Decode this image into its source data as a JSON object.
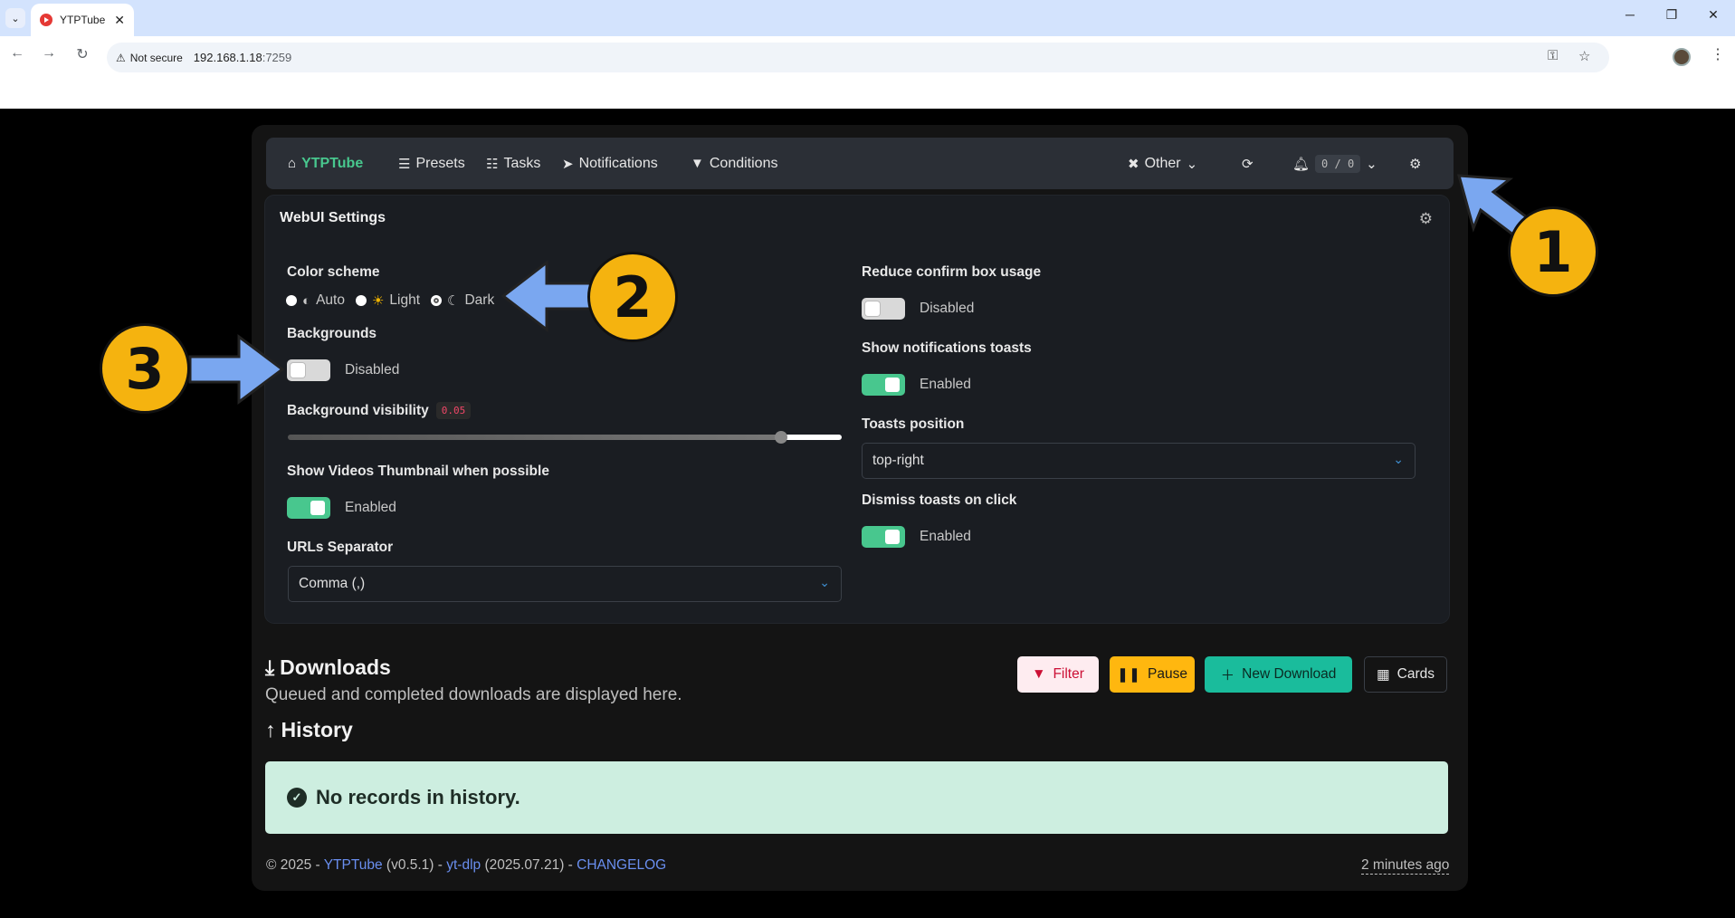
{
  "browser": {
    "tab_title": "YTPTube",
    "not_secure": "Not secure",
    "url_host": "192.168.1.18",
    "url_port": ":7259"
  },
  "nav": {
    "brand": "YTPTube",
    "presets": "Presets",
    "tasks": "Tasks",
    "notifications": "Notifications",
    "conditions": "Conditions",
    "other": "Other",
    "counter": "0 / 0"
  },
  "settings": {
    "title": "WebUI Settings",
    "color_scheme": {
      "label": "Color scheme",
      "options": [
        "Auto",
        "Light",
        "Dark"
      ],
      "selected": "Dark"
    },
    "backgrounds": {
      "label": "Backgrounds",
      "state": "Disabled"
    },
    "background_visibility": {
      "label": "Background visibility",
      "value": "0.05",
      "level": 0.89
    },
    "thumbnail": {
      "label": "Show Videos Thumbnail when possible",
      "state": "Enabled"
    },
    "urls_separator": {
      "label": "URLs Separator",
      "value": "Comma (,)"
    },
    "reduce_confirm": {
      "label": "Reduce confirm box usage",
      "state": "Disabled"
    },
    "show_toasts": {
      "label": "Show notifications toasts",
      "state": "Enabled"
    },
    "toasts_position": {
      "label": "Toasts position",
      "value": "top-right"
    },
    "dismiss_toasts": {
      "label": "Dismiss toasts on click",
      "state": "Enabled"
    }
  },
  "downloads": {
    "title": "Downloads",
    "subtitle": "Queued and completed downloads are displayed here.",
    "history_title": "History",
    "empty_message": "No records in history.",
    "buttons": {
      "filter": "Filter",
      "pause": "Pause",
      "new_download": "New Download",
      "cards": "Cards"
    }
  },
  "footer": {
    "copyright": "© 2025 - ",
    "app_link": "YTPTube",
    "app_version": " (v0.5.1) - ",
    "ytdlp_link": "yt-dlp",
    "ytdlp_version": " (2025.07.21) - ",
    "changelog_link": "CHANGELOG",
    "updated": "2 minutes ago"
  },
  "callouts": {
    "one": "1",
    "two": "2",
    "three": "3"
  },
  "colors": {
    "accent_green": "#48c78e",
    "callout_yellow": "#f5b30f",
    "arrow_blue": "#7aa7f0"
  }
}
